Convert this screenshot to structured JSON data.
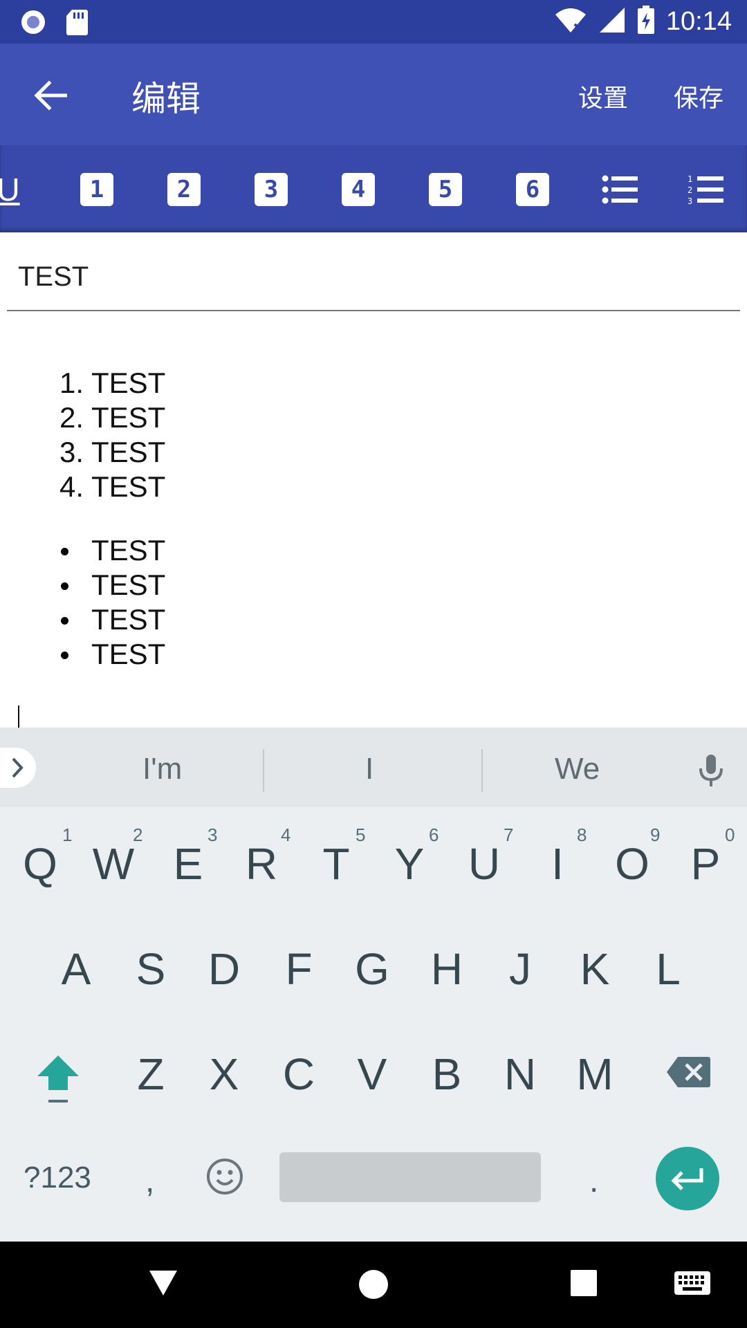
{
  "status_bar": {
    "time": "10:14",
    "icons": [
      "radio-icon",
      "sd-card-icon",
      "wifi-icon",
      "cell-signal-icon",
      "battery-charging-icon"
    ]
  },
  "app_bar": {
    "title": "编辑",
    "settings_label": "设置",
    "save_label": "保存",
    "color": "#3f51b5"
  },
  "format_toolbar": {
    "underline_label": "U",
    "headings": [
      "1",
      "2",
      "3",
      "4",
      "5",
      "6"
    ],
    "color": "#3949ab"
  },
  "editor": {
    "title_value": "TEST",
    "ordered_list": [
      {
        "num": "1.",
        "text": "TEST"
      },
      {
        "num": "2.",
        "text": "TEST"
      },
      {
        "num": "3.",
        "text": "TEST"
      },
      {
        "num": "4.",
        "text": "TEST"
      }
    ],
    "bullet_list": [
      "TEST",
      "TEST",
      "TEST",
      "TEST"
    ]
  },
  "keyboard": {
    "suggestions": [
      "I'm",
      "I",
      "We"
    ],
    "row1": [
      {
        "key": "Q",
        "hint": "1"
      },
      {
        "key": "W",
        "hint": "2"
      },
      {
        "key": "E",
        "hint": "3"
      },
      {
        "key": "R",
        "hint": "4"
      },
      {
        "key": "T",
        "hint": "5"
      },
      {
        "key": "Y",
        "hint": "6"
      },
      {
        "key": "U",
        "hint": "7"
      },
      {
        "key": "I",
        "hint": "8"
      },
      {
        "key": "O",
        "hint": "9"
      },
      {
        "key": "P",
        "hint": "0"
      }
    ],
    "row2": [
      "A",
      "S",
      "D",
      "F",
      "G",
      "H",
      "J",
      "K",
      "L"
    ],
    "row3": [
      "Z",
      "X",
      "C",
      "V",
      "B",
      "N",
      "M"
    ],
    "symbols_label": "?123",
    "comma_label": ",",
    "period_label": ".",
    "accent_color": "#26a69a"
  }
}
